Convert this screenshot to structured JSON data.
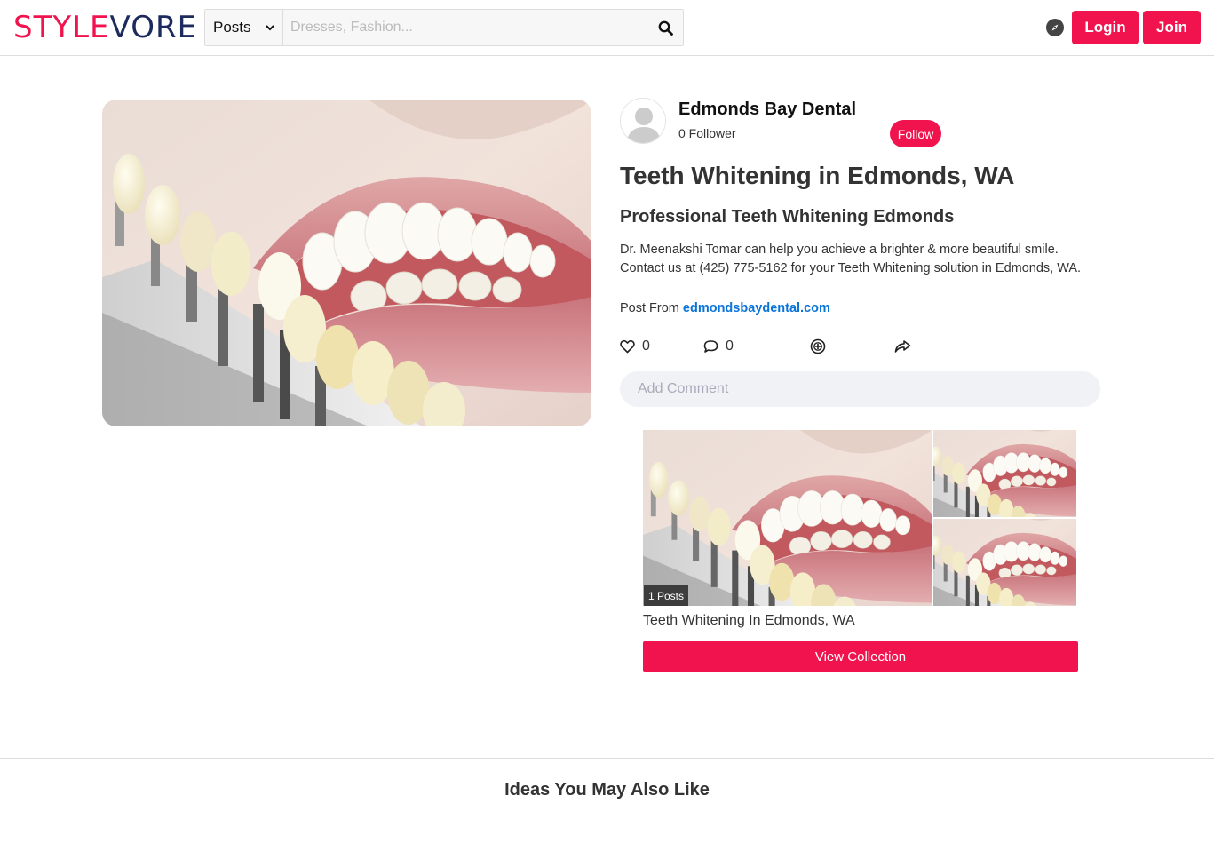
{
  "header": {
    "logo_part1": "STYLE",
    "logo_part2": "VORE",
    "search_type": "Posts",
    "search_placeholder": "Dresses, Fashion...",
    "login_label": "Login",
    "join_label": "Join",
    "brand_color": "#f0134d",
    "logo_secondary_color": "#1c2a5e"
  },
  "author": {
    "name": "Edmonds Bay Dental",
    "followers": "0 Follower",
    "follow_label": "Follow"
  },
  "post": {
    "title": "Teeth Whitening in Edmonds, WA",
    "subtitle": "Professional Teeth Whitening Edmonds",
    "description": "Dr. Meenakshi Tomar can help you achieve a brighter & more beautiful smile. Contact us at (425) 775-5162 for your Teeth Whitening solution in Edmonds, WA.",
    "source_prefix": "Post From",
    "source_link": "edmondsbaydental.com",
    "likes": "0",
    "comments": "0",
    "comment_placeholder": "Add Comment",
    "link_color": "#0a74d9"
  },
  "collection": {
    "badge": "1 Posts",
    "title": "Teeth Whitening In Edmonds, WA",
    "view_label": "View Collection"
  },
  "ideas": {
    "title": "Ideas You May Also Like"
  },
  "icons": [
    "chevron-down-icon",
    "search-icon",
    "compass-icon",
    "heart-icon",
    "comment-icon",
    "pin-icon",
    "share-icon",
    "user-placeholder-icon"
  ]
}
